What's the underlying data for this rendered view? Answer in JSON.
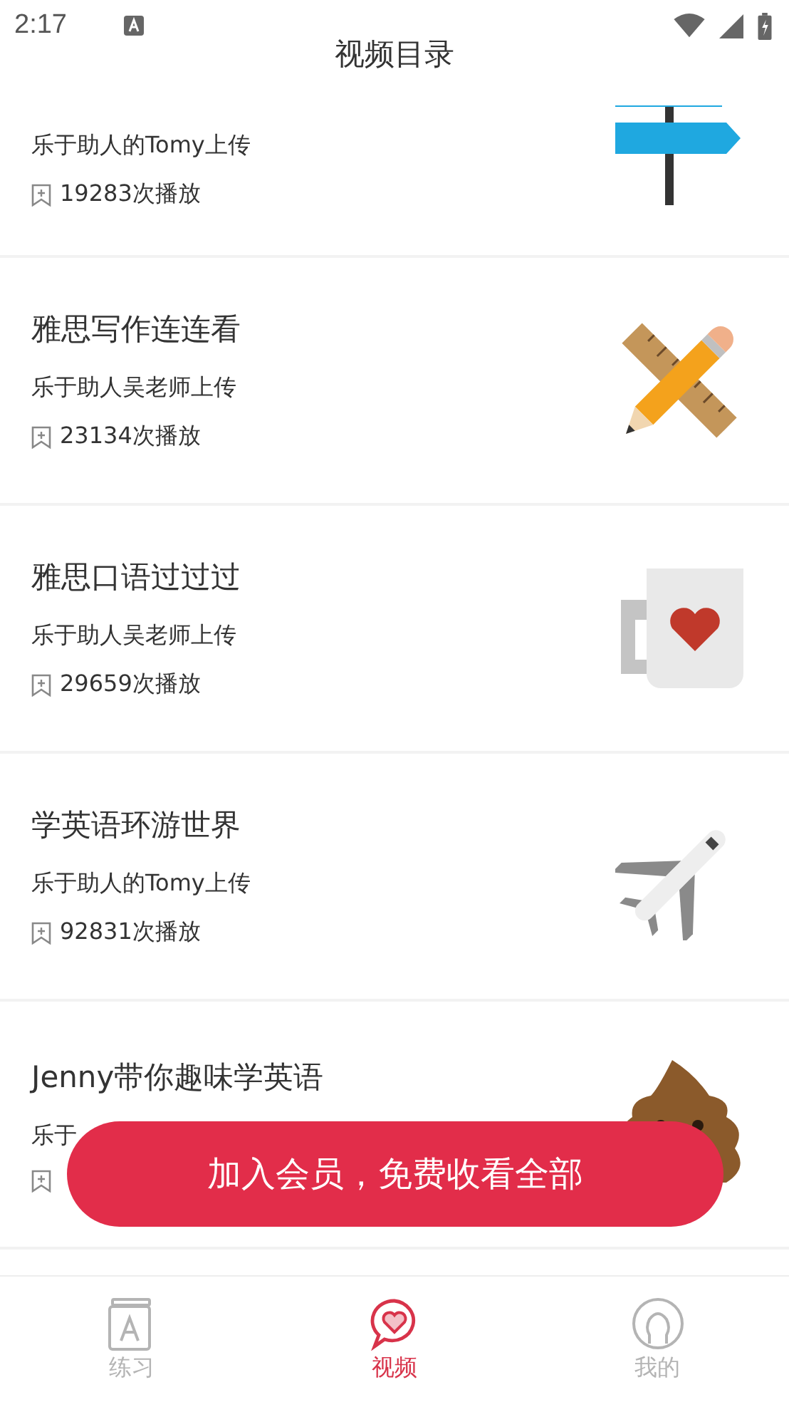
{
  "status_bar": {
    "time": "2:17"
  },
  "header": {
    "title": "视频目录"
  },
  "videos": [
    {
      "kind": "signpost",
      "uploader": "乐于助人的Tomy上传",
      "plays": "19283次播放"
    },
    {
      "kind": "pencil-ruler",
      "title": "雅思写作连连看",
      "uploader": "乐于助人吴老师上传",
      "plays": "23134次播放"
    },
    {
      "kind": "mug",
      "title": "雅思口语过过过",
      "uploader": "乐于助人吴老师上传",
      "plays": "29659次播放"
    },
    {
      "kind": "airplane",
      "title": "学英语环游世界",
      "uploader": "乐于助人的Tomy上传",
      "plays": "92831次播放"
    },
    {
      "kind": "poop",
      "title": "Jenny带你趣味学英语",
      "uploader": "乐于"
    }
  ],
  "join_button": {
    "label": "加入会员，免费收看全部"
  },
  "tabs": [
    {
      "kind": "book",
      "label": "练习",
      "selected": false
    },
    {
      "kind": "chat-heart",
      "label": "视频",
      "selected": true
    },
    {
      "kind": "person",
      "label": "我的",
      "selected": false
    }
  ]
}
